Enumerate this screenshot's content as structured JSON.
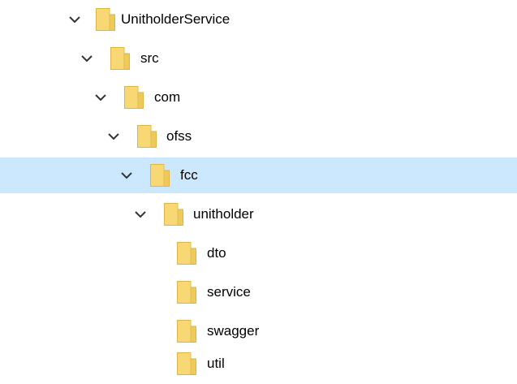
{
  "colors": {
    "selection_background": "#cce8ff",
    "folder_fill": "#f8d775",
    "folder_dark": "#dcb545",
    "chevron": "#333333",
    "text": "#000000"
  },
  "tree": {
    "items": [
      {
        "label": "UnitholderService",
        "expanded": true,
        "selected": false,
        "icon": "folder-icon",
        "toggle_icon": "chevron-down-icon"
      },
      {
        "label": "src",
        "expanded": true,
        "selected": false,
        "icon": "folder-icon",
        "toggle_icon": "chevron-down-icon"
      },
      {
        "label": "com",
        "expanded": true,
        "selected": false,
        "icon": "folder-icon",
        "toggle_icon": "chevron-down-icon"
      },
      {
        "label": "ofss",
        "expanded": true,
        "selected": false,
        "icon": "folder-icon",
        "toggle_icon": "chevron-down-icon"
      },
      {
        "label": "fcc",
        "expanded": true,
        "selected": true,
        "icon": "folder-icon",
        "toggle_icon": "chevron-down-icon"
      },
      {
        "label": "unitholder",
        "expanded": true,
        "selected": false,
        "icon": "folder-icon",
        "toggle_icon": "chevron-down-icon"
      },
      {
        "label": "dto",
        "expanded": false,
        "selected": false,
        "icon": "folder-icon"
      },
      {
        "label": "service",
        "expanded": false,
        "selected": false,
        "icon": "folder-icon"
      },
      {
        "label": "swagger",
        "expanded": false,
        "selected": false,
        "icon": "folder-icon"
      },
      {
        "label": "util",
        "expanded": false,
        "selected": false,
        "icon": "folder-icon"
      }
    ]
  }
}
